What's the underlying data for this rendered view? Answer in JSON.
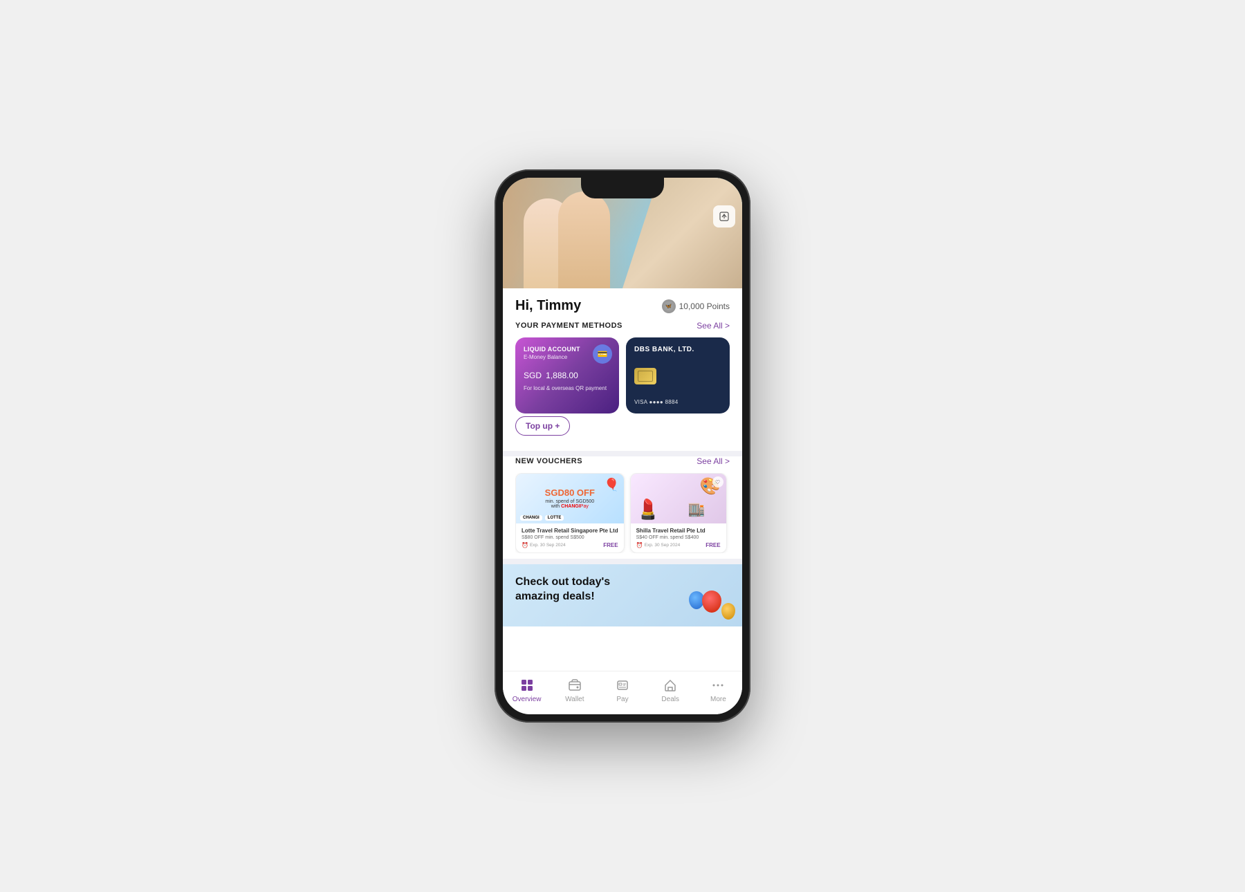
{
  "phone": {
    "hero": {
      "export_btn": "⬆"
    },
    "greeting": {
      "text": "Hi, Timmy",
      "points_label": "10,000 Points"
    },
    "payment_methods": {
      "section_title": "YOUR PAYMENT METHODS",
      "see_all": "See All >",
      "liquid_card": {
        "label": "LIQUID ACCOUNT",
        "sublabel": "E-Money Balance",
        "currency": "SGD",
        "amount": "1,888.00",
        "footer": "For local & overseas QR payment"
      },
      "dbs_card": {
        "title": "DBS BANK, LTD.",
        "visa_text": "VISA ●●●● 8884"
      },
      "topup_btn": "Top up +"
    },
    "vouchers": {
      "section_title": "NEW VOUCHERS",
      "see_all": "See All >",
      "items": [
        {
          "big_text": "SGD80 OFF",
          "sub_text": "min. spend of SGD500\nwith CHANGIPay",
          "merchant": "Lotte Travel Retail Singapore Pte Ltd",
          "desc": "S$80 OFF min. spend S$500",
          "exp": "Exp. 30 Sep 2024",
          "price": "FREE"
        },
        {
          "merchant": "Shilla Travel Retail Pte Ltd",
          "desc": "S$40 OFF min. spend S$400",
          "exp": "Exp. 30 Sep 2024",
          "price": "FREE"
        }
      ]
    },
    "deals_banner": {
      "title": "Check out today's\namazing deals!"
    },
    "bottom_nav": {
      "items": [
        {
          "label": "Overview",
          "active": true,
          "icon": "grid"
        },
        {
          "label": "Wallet",
          "active": false,
          "icon": "wallet"
        },
        {
          "label": "Pay",
          "active": false,
          "icon": "pay"
        },
        {
          "label": "Deals",
          "active": false,
          "icon": "deals"
        },
        {
          "label": "More",
          "active": false,
          "icon": "more"
        }
      ]
    }
  }
}
